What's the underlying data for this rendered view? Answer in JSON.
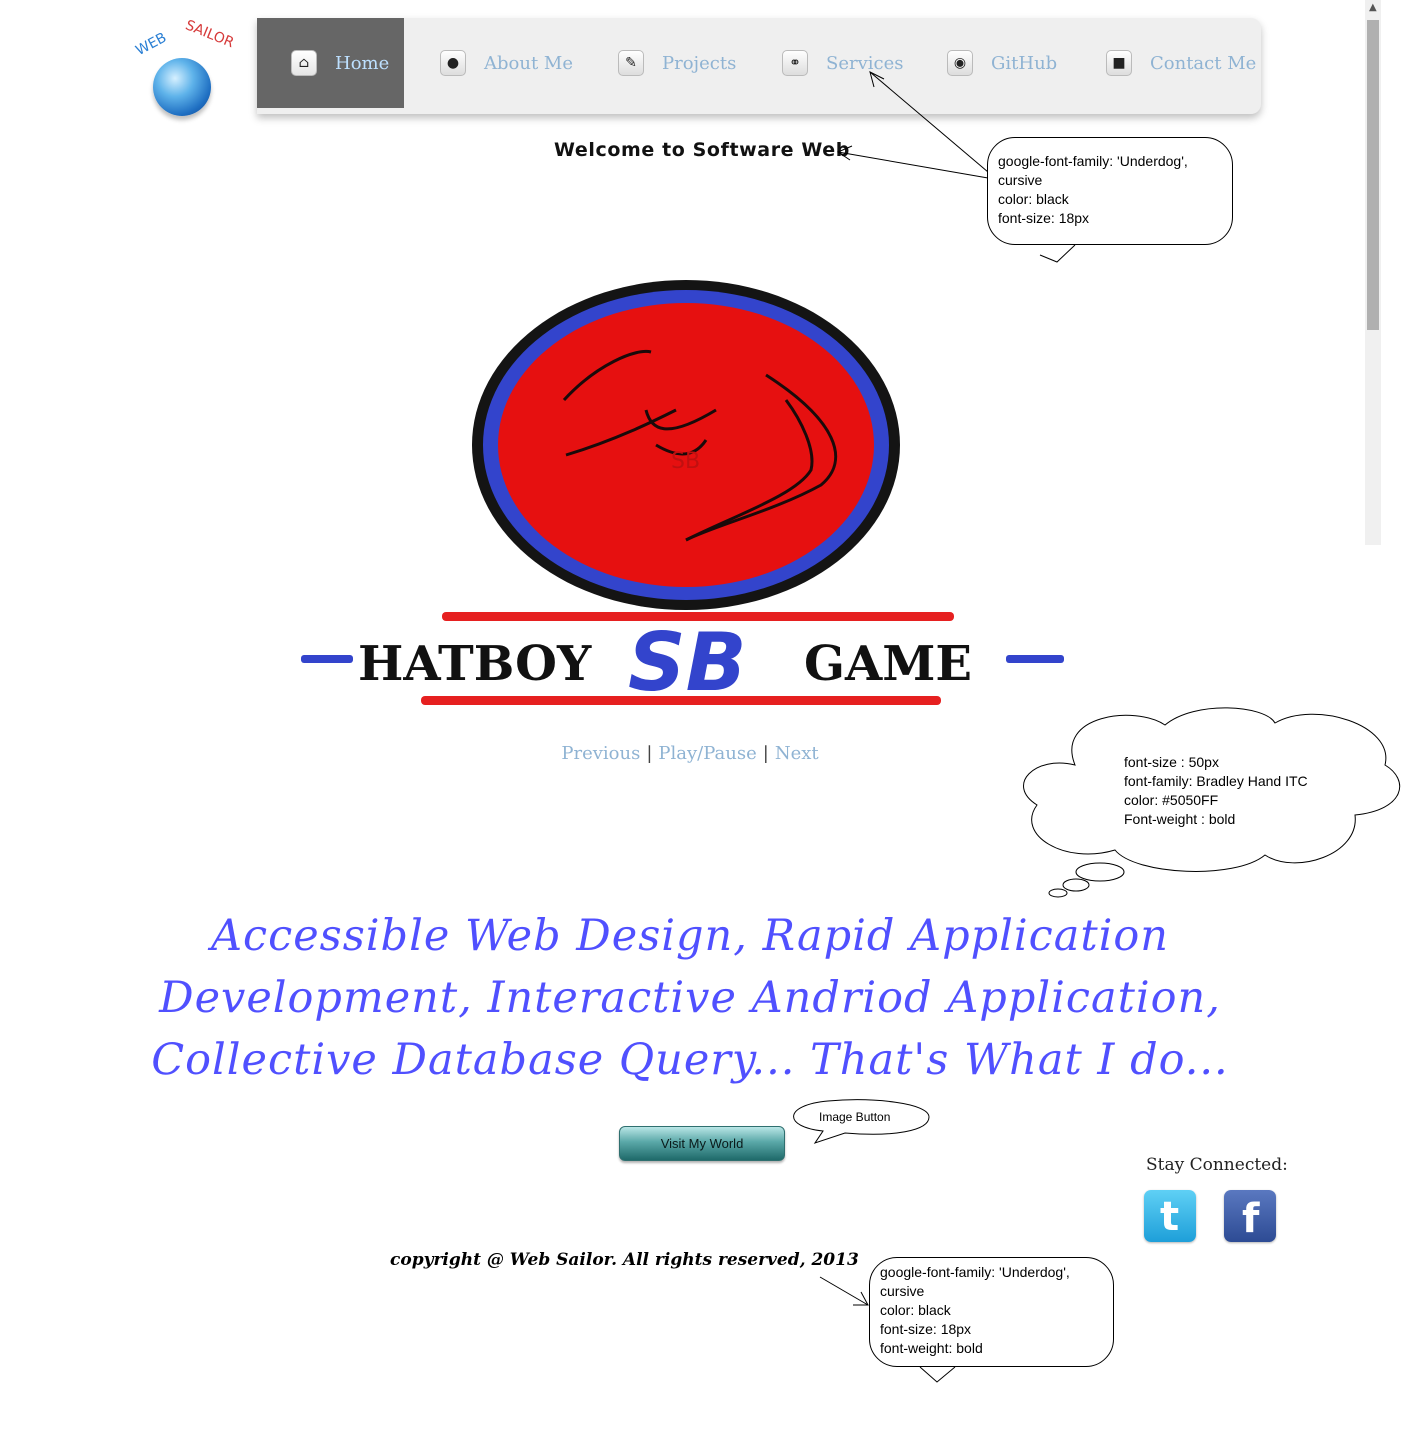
{
  "logo": {
    "brand_text": "WEB SAILOR"
  },
  "nav": {
    "items": [
      {
        "label": "Home",
        "icon": "home-icon"
      },
      {
        "label": "About Me",
        "icon": "user-icon"
      },
      {
        "label": "Projects",
        "icon": "pencil-icon"
      },
      {
        "label": "Services",
        "icon": "link-icon"
      },
      {
        "label": "GitHub",
        "icon": "github-icon"
      },
      {
        "label": "Contact Me",
        "icon": "chat-icon"
      }
    ]
  },
  "welcome": "Welcome to Software Web",
  "notes": {
    "welcome_note": [
      "google-font-family: 'Underdog',",
      "cursive",
      "color: black",
      "font-size: 18px"
    ],
    "tagline_note": [
      "font-size : 50px",
      "font-family: Bradley Hand ITC",
      "color: #5050FF",
      "Font-weight : bold"
    ],
    "button_note": "Image Button",
    "copyright_note": [
      "google-font-family: 'Underdog',",
      "cursive",
      "color: black",
      "font-size: 18px",
      "font-weight: bold"
    ]
  },
  "slide": {
    "title_left": "HATBOY",
    "title_mid": "SB",
    "title_right": "GAME",
    "inner_text": "SB"
  },
  "slider_controls": {
    "previous": "Previous",
    "play_pause": "Play/Pause",
    "next": "Next",
    "separator": "|"
  },
  "tagline": {
    "line1": "Accessible Web Design, Rapid Application",
    "line2": "Development, Interactive Andriod Application,",
    "line3": "Collective Database Query... That's What I do..."
  },
  "button": {
    "label": "Visit My World"
  },
  "social": {
    "heading": "Stay Connected:"
  },
  "copyright": "copyright @ Web Sailor. All rights reserved, 2013",
  "colors": {
    "tagline": "#5050ff",
    "nav_text": "#8fb3d3",
    "nav_active_bg": "#666666",
    "nav_bg": "#efefef"
  }
}
